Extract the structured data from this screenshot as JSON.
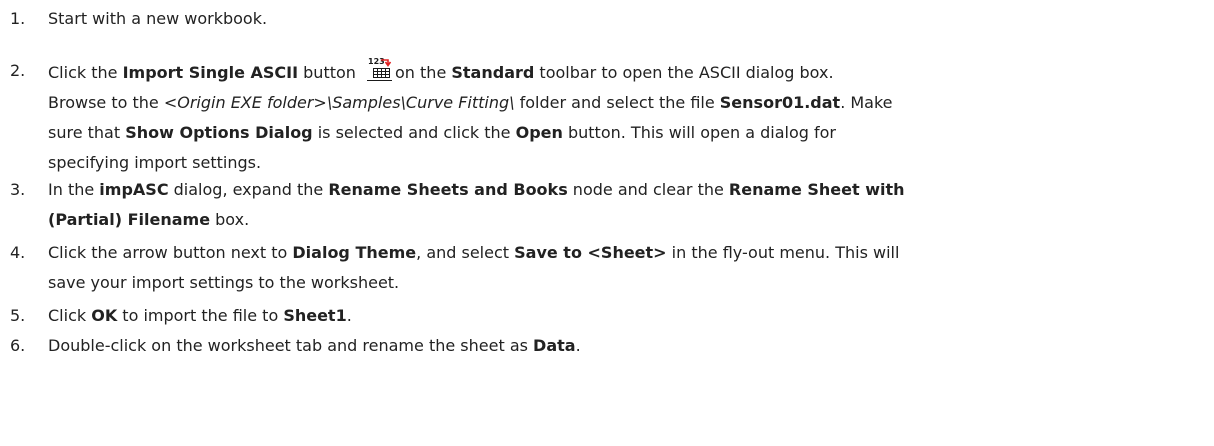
{
  "steps": [
    {
      "num": "1.",
      "lines": [
        [
          {
            "t": "Start with a new workbook."
          }
        ]
      ]
    },
    {
      "num": "2.",
      "lines": [
        [
          {
            "t": "Click the "
          },
          {
            "t": "Import Single ASCII",
            "b": true
          },
          {
            "t": " button "
          },
          {
            "icon": "import-single-ascii-icon"
          },
          {
            "t": "on the "
          },
          {
            "t": "Standard",
            "b": true
          },
          {
            "t": " toolbar to open the ASCII dialog box."
          }
        ],
        [
          {
            "t": "Browse to the "
          },
          {
            "t": "<Origin EXE folder>\\Samples\\Curve Fitting\\",
            "i": true
          },
          {
            "t": " folder and select the file "
          },
          {
            "t": "Sensor01.dat",
            "b": true
          },
          {
            "t": ". Make"
          }
        ],
        [
          {
            "t": "sure that "
          },
          {
            "t": "Show Options Dialog",
            "b": true
          },
          {
            "t": " is selected and click the "
          },
          {
            "t": "Open",
            "b": true
          },
          {
            "t": " button. This will open a dialog for"
          }
        ],
        [
          {
            "t": "specifying import settings."
          }
        ]
      ]
    },
    {
      "num": "3.",
      "lines": [
        [
          {
            "t": "In the "
          },
          {
            "t": "impASC",
            "b": true
          },
          {
            "t": " dialog, expand the "
          },
          {
            "t": "Rename Sheets and Books",
            "b": true
          },
          {
            "t": " node and clear the "
          },
          {
            "t": "Rename Sheet with",
            "b": true
          }
        ],
        [
          {
            "t": "(Partial) Filename",
            "b": true
          },
          {
            "t": " box."
          }
        ]
      ]
    },
    {
      "num": "4.",
      "lines": [
        [
          {
            "t": "Click the arrow button next to "
          },
          {
            "t": "Dialog Theme",
            "b": true
          },
          {
            "t": ", and select "
          },
          {
            "t": "Save to <Sheet>",
            "b": true
          },
          {
            "t": " in the fly-out menu. This will"
          }
        ],
        [
          {
            "t": "save your import settings to the worksheet."
          }
        ]
      ]
    },
    {
      "num": "5.",
      "lines": [
        [
          {
            "t": "Click "
          },
          {
            "t": "OK",
            "b": true
          },
          {
            "t": " to import the file to "
          },
          {
            "t": "Sheet1",
            "b": true
          },
          {
            "t": "."
          }
        ]
      ]
    },
    {
      "num": "6.",
      "lines": [
        [
          {
            "t": "Double-click on the worksheet tab and rename the sheet as "
          },
          {
            "t": "Data",
            "b": true
          },
          {
            "t": "."
          }
        ]
      ]
    }
  ],
  "icon_label": "123",
  "colors": {
    "text": "#222222",
    "icon_arrow": "#e02020",
    "icon_grid": "#1a1a1a"
  }
}
